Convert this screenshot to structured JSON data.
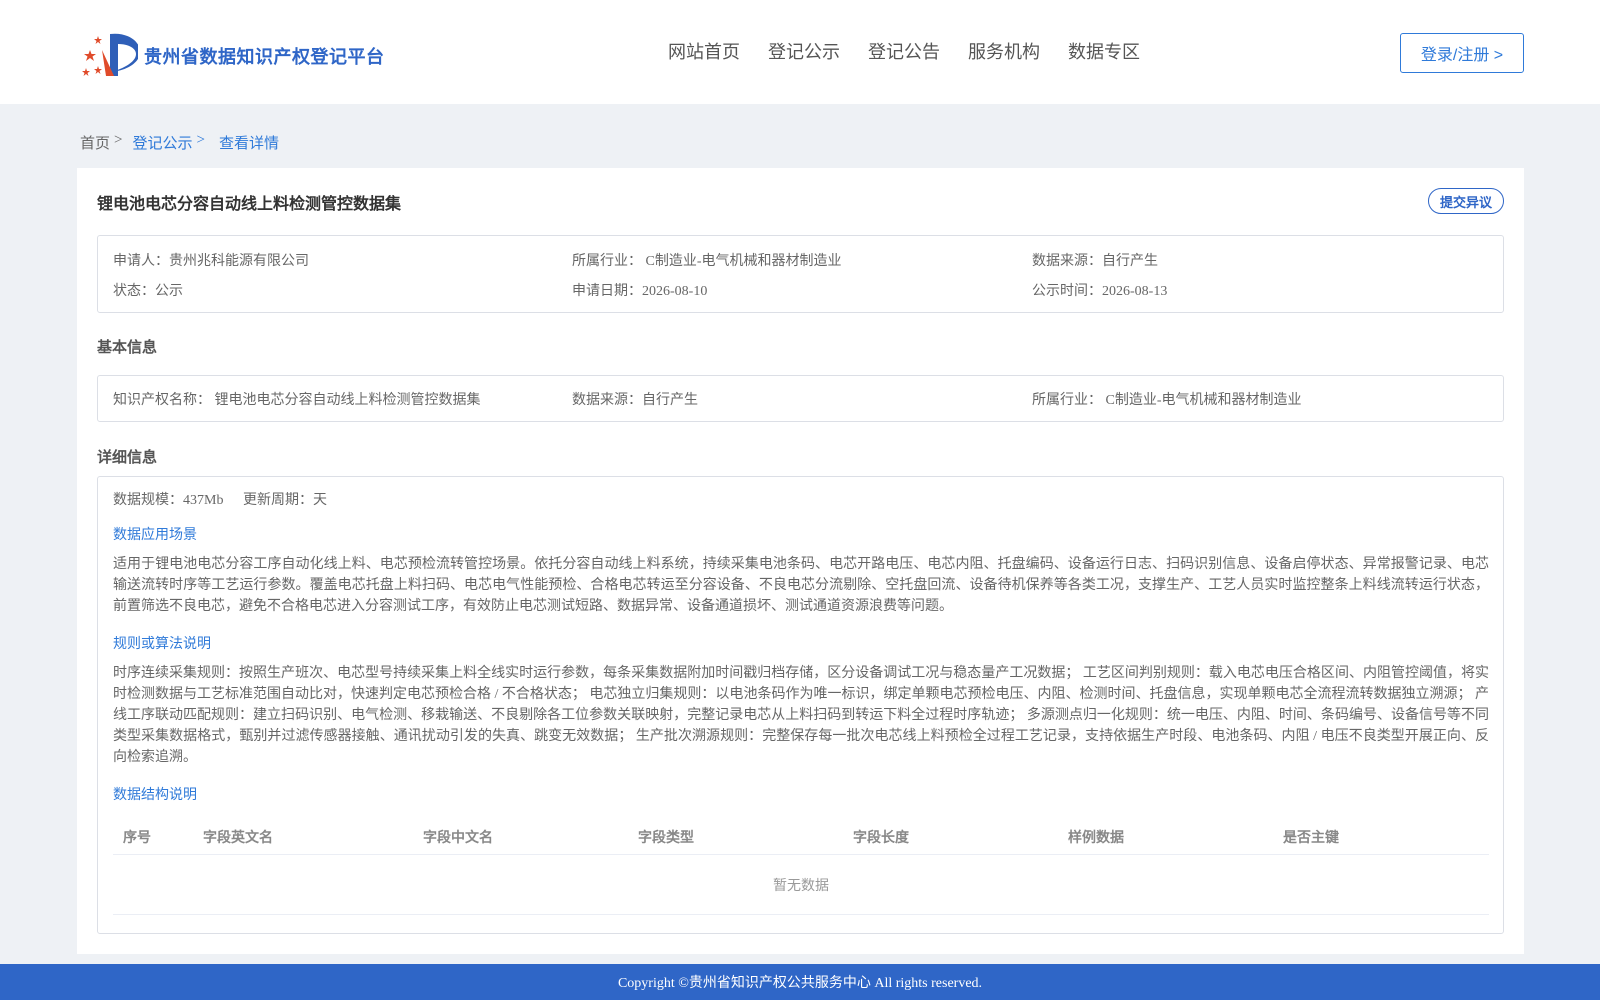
{
  "header": {
    "brand": "贵州省数据知识产权登记平台",
    "nav": [
      "网站首页",
      "登记公示",
      "登记公告",
      "服务机构",
      "数据专区"
    ],
    "login_label": "登录/注册 >",
    "colors": {
      "brand": "#2f66c7",
      "accent": "#2f7ad9"
    }
  },
  "breadcrumb": {
    "home": "首页",
    "sep": ">",
    "level1": "登记公示",
    "current": "查看详情"
  },
  "record": {
    "title": "锂电池电芯分容自动线上料检测管控数据集",
    "objection_label": "提交异议",
    "summary": {
      "applicant": "申请人：贵州兆科能源有限公司",
      "industry": "所属行业： C制造业-电气机械和器材制造业",
      "source": "数据来源：自行产生",
      "status": "状态：公示",
      "apply_date": "申请日期：2026-08-10",
      "publish_date": "公示时间：2026-08-13"
    }
  },
  "basic": {
    "section_title": "基本信息",
    "ip_name": "知识产权名称： 锂电池电芯分容自动线上料检测管控数据集",
    "source": "数据来源：自行产生",
    "industry": "所属行业： C制造业-电气机械和器材制造业"
  },
  "detail": {
    "section_title": "详细信息",
    "scale": "数据规模：437Mb",
    "cycle": "更新周期：天",
    "scene_title": "数据应用场景",
    "scene_text": "适用于锂电池电芯分容工序自动化线上料、电芯预检流转管控场景。依托分容自动线上料系统，持续采集电池条码、电芯开路电压、电芯内阻、托盘编码、设备运行日志、扫码识别信息、设备启停状态、异常报警记录、电芯输送流转时序等工艺运行参数。覆盖电芯托盘上料扫码、电芯电气性能预检、合格电芯转运至分容设备、不良电芯分流剔除、空托盘回流、设备待机保养等各类工况，支撑生产、工艺人员实时监控整条上料线流转运行状态，前置筛选不良电芯，避免不合格电芯进入分容测试工序，有效防止电芯测试短路、数据异常、设备通道损坏、测试通道资源浪费等问题。",
    "rule_title": "规则或算法说明",
    "rule_text": "时序连续采集规则：按照生产班次、电芯型号持续采集上料全线实时运行参数，每条采集数据附加时间戳归档存储，区分设备调试工况与稳态量产工况数据； 工艺区间判别规则：载入电芯电压合格区间、内阻管控阈值，将实时检测数据与工艺标准范围自动比对，快速判定电芯预检合格 / 不合格状态； 电芯独立归集规则：以电池条码作为唯一标识，绑定单颗电芯预检电压、内阻、检测时间、托盘信息，实现单颗电芯全流程流转数据独立溯源； 产线工序联动匹配规则：建立扫码识别、电气检测、移栽输送、不良剔除各工位参数关联映射，完整记录电芯从上料扫码到转运下料全过程时序轨迹； 多源测点归一化规则：统一电压、内阻、时间、条码编号、设备信号等不同类型采集数据格式，甄别并过滤传感器接触、通讯扰动引发的失真、跳变无效数据； 生产批次溯源规则：完整保存每一批次电芯线上料预检全过程工艺记录，支持依据生产时段、电池条码、内阻 / 电压不良类型开展正向、反向检索追溯。",
    "structure_title": "数据结构说明",
    "table_headers": [
      "序号",
      "字段英文名",
      "字段中文名",
      "字段类型",
      "字段长度",
      "样例数据",
      "是否主键"
    ],
    "table_empty": "暂无数据"
  },
  "footer": {
    "copyright": "Copyright ©贵州省知识产权公共服务中心 All rights reserved."
  }
}
